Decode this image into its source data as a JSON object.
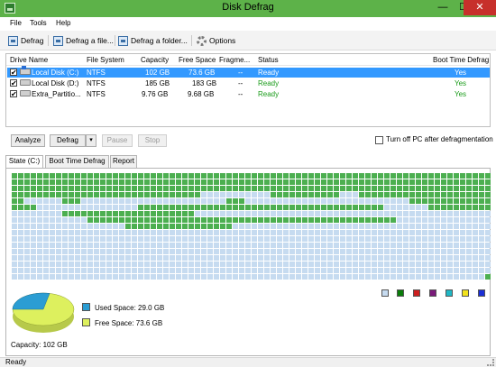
{
  "window": {
    "title": "Disk Defrag",
    "min_glyph": "—",
    "max_glyph": "☐",
    "close_glyph": "✕"
  },
  "menu": {
    "items": [
      "File",
      "Tools",
      "Help"
    ]
  },
  "toolbar": {
    "defrag_label": "Defrag",
    "defrag_file_label": "Defrag a file...",
    "defrag_folder_label": "Defrag a folder...",
    "options_label": "Options"
  },
  "drives": {
    "columns": [
      "Drive Name",
      "File System",
      "Capacity",
      "Free Space",
      "Fragme...",
      "Status",
      "Boot Time Defrag"
    ],
    "rows": [
      {
        "name": "Local Disk (C:)",
        "fs": "NTFS",
        "capacity": "102 GB",
        "free": "73.6 GB",
        "frag": "--",
        "status": "Ready",
        "boot": "Yes",
        "checked": "✔",
        "selected": true
      },
      {
        "name": "Local Disk (D:)",
        "fs": "NTFS",
        "capacity": "185 GB",
        "free": "183 GB",
        "frag": "--",
        "status": "Ready",
        "boot": "Yes",
        "checked": "✔",
        "selected": false
      },
      {
        "name": "Extra_Partitio...",
        "fs": "NTFS",
        "capacity": "9.76 GB",
        "free": "9.68 GB",
        "frag": "--",
        "status": "Ready",
        "boot": "Yes",
        "checked": "✔",
        "selected": false
      }
    ]
  },
  "actions": {
    "analyze": "Analyze",
    "defrag": "Defrag",
    "defrag_arrow": "▾",
    "pause": "Pause",
    "stop": "Stop",
    "turn_off": "Turn off PC after defragmentation"
  },
  "tabs": [
    "State (C:)",
    "Boot Time Defrag",
    "Report"
  ],
  "map": {
    "colors": {
      "used": "#4caf50",
      "free": "#c6dbf0"
    },
    "legend_colors": [
      "#c6dbf0",
      "#0a7d0a",
      "#cc1f1f",
      "#7a1a7a",
      "#1fb8c6",
      "#f2e31c",
      "#1a2fd6"
    ]
  },
  "disk": {
    "used_label": "Used Space: 29.0 GB",
    "free_label": "Free Space: 73.6 GB",
    "capacity_label": "Capacity: 102 GB",
    "used_fraction": 0.283,
    "colors": {
      "used": "#2b9dd3",
      "free": "#ddf05e"
    }
  },
  "status": {
    "text": "Ready"
  }
}
